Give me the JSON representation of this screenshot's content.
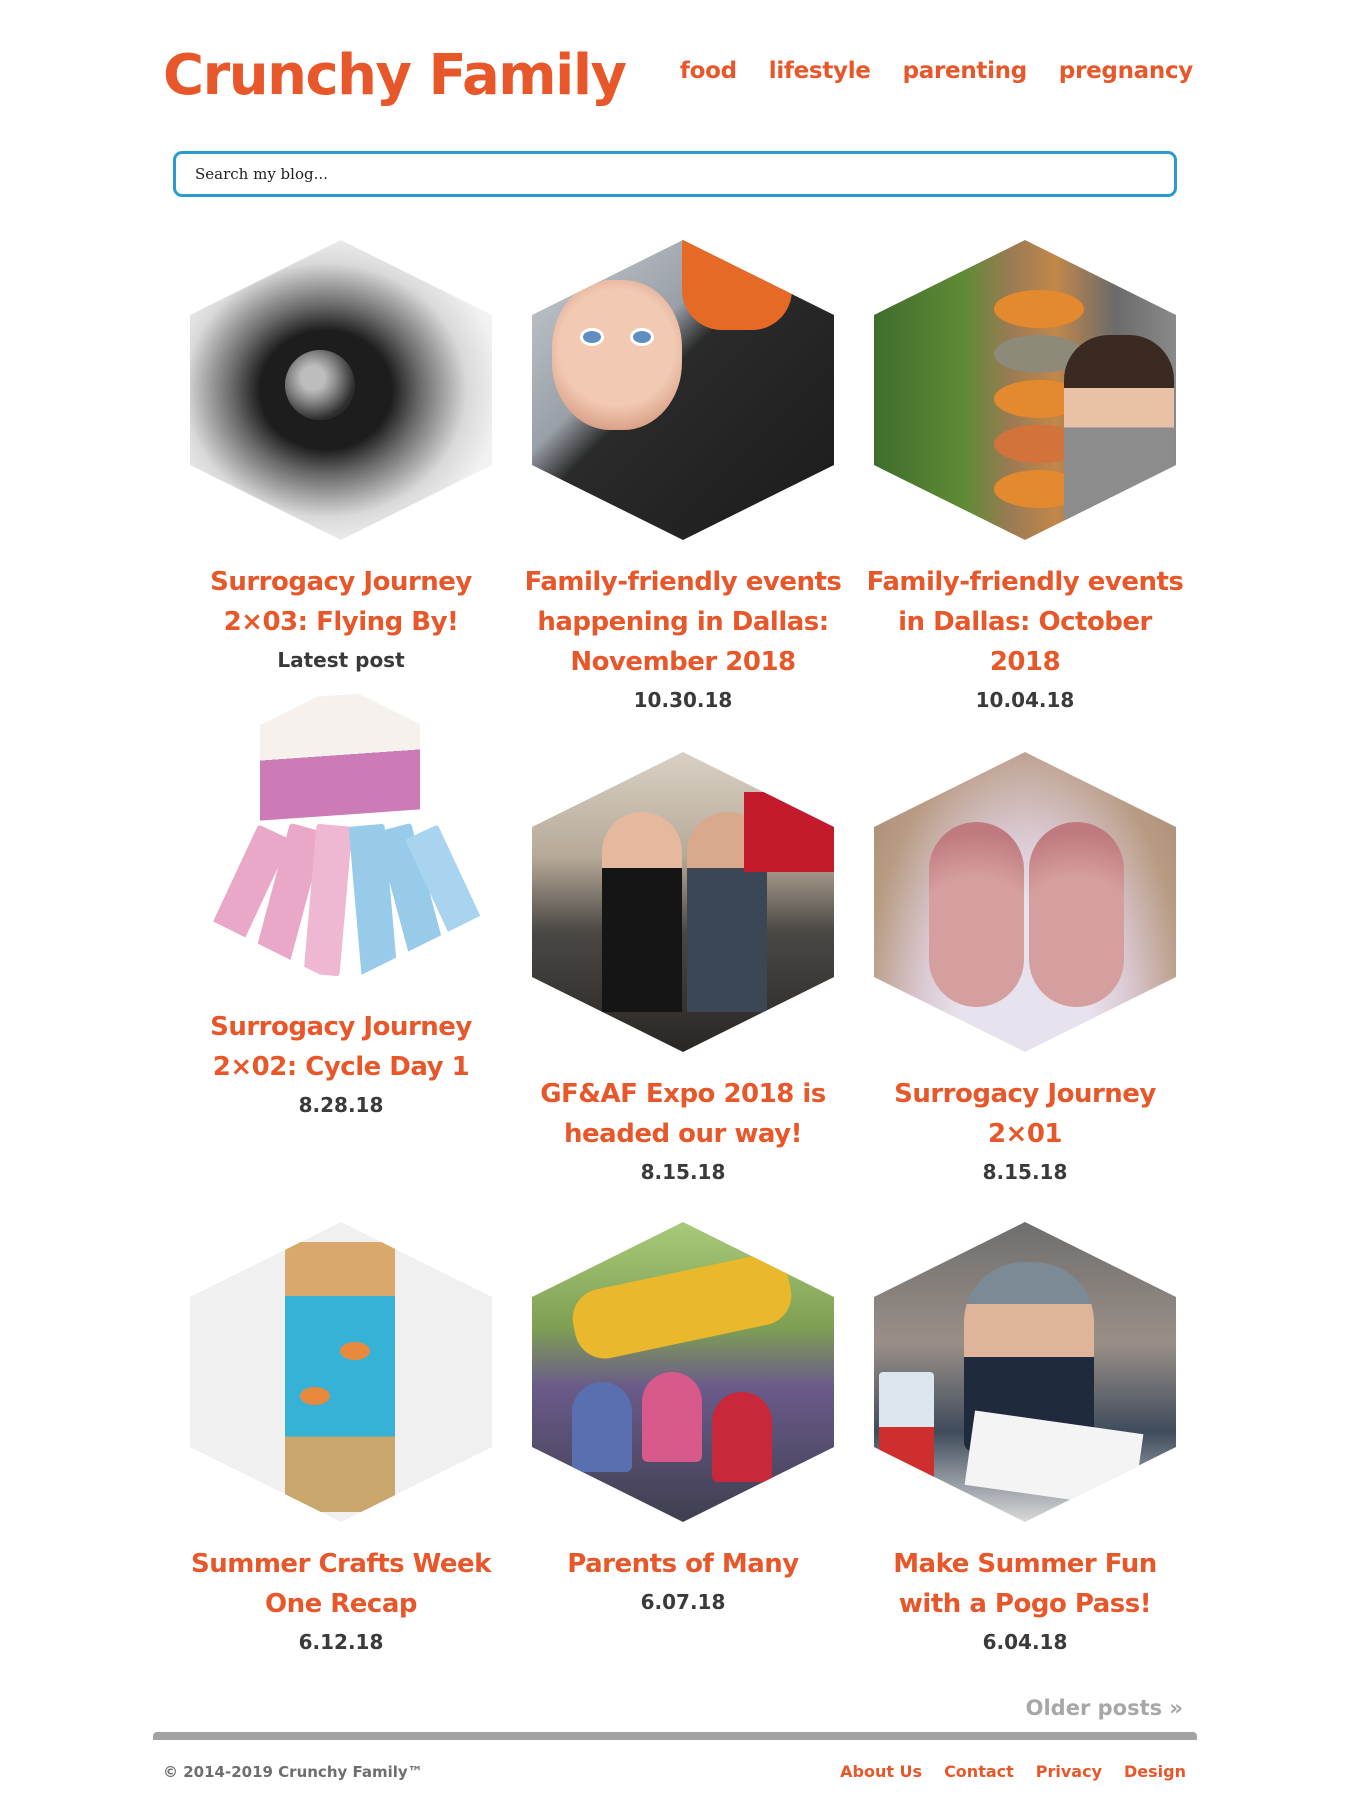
{
  "site": {
    "logo": "Crunchy Family",
    "nav": [
      "food",
      "lifestyle",
      "parenting",
      "pregnancy"
    ]
  },
  "search": {
    "placeholder": "Search my blog..."
  },
  "posts": [
    {
      "title": "Surrogacy Journey 2×03: Flying By!",
      "date": "Latest post",
      "image": "pebbles-in-snow"
    },
    {
      "title": "Family-friendly events happening in Dallas: November 2018",
      "date": "10.30.18",
      "image": "baby-in-carrier"
    },
    {
      "title": "Family-friendly events in Dallas: October 2018",
      "date": "10.04.18",
      "image": "pumpkin-stack"
    },
    {
      "title": "Surrogacy Journey 2×02: Cycle Day 1",
      "date": "8.28.18",
      "image": "ovulation-test-kit"
    },
    {
      "title": "GF&AF Expo 2018 is headed our way!",
      "date": "8.15.18",
      "image": "expo-booth"
    },
    {
      "title": "Surrogacy Journey 2×01",
      "date": "8.15.18",
      "image": "baby-feet"
    },
    {
      "title": "Summer Crafts Week One Recap",
      "date": "6.12.18",
      "image": "graham-cracker-craft"
    },
    {
      "title": "Parents of Many",
      "date": "6.07.18",
      "image": "kids-on-playground"
    },
    {
      "title": "Make Summer Fun with a Pogo Pass!",
      "date": "6.04.18",
      "image": "boy-eating"
    }
  ],
  "pagination": {
    "older": "Older posts »"
  },
  "footer": {
    "copyright": "© 2014-2019 Crunchy Family™",
    "links": [
      "About Us",
      "Contact",
      "Privacy",
      "Design"
    ]
  },
  "colors": {
    "accent": "#e8572a",
    "search_border": "#2a9bd1",
    "muted": "#a3a3a3",
    "text": "#3a3a3a"
  }
}
